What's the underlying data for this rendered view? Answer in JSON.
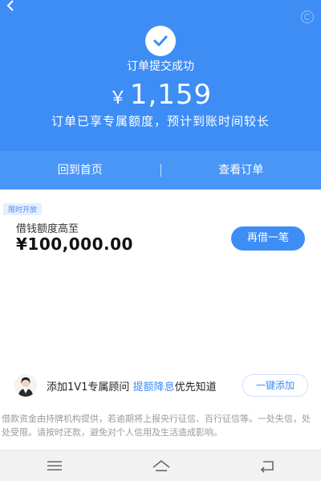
{
  "header": {
    "status_text": "订单提交成功",
    "currency_symbol": "￥",
    "amount": "1,159",
    "notice": "订单已享专属额度，预计到账时间较长",
    "background_color": "#3d8df5"
  },
  "actions": {
    "home_label": "回到首页",
    "view_order_label": "查看订单"
  },
  "card": {
    "badge": "限时开放",
    "limit_label": "借钱额度高至",
    "limit_value": "¥100,000.00",
    "borrow_button": "再借一笔"
  },
  "advisor": {
    "text_prefix": "添加1V1专属顾问 ",
    "highlight": "提额降息",
    "text_suffix": "优先知道",
    "add_button": "一键添加"
  },
  "disclaimer": "借款资金由持牌机构提供，若逾期将上报央行征信、百行征信等。一处失信，处处受限。请按时还款，避免对个人信用及生活造成影响。",
  "icons": {
    "back": "back-arrow-icon",
    "check": "check-icon",
    "menu": "menu-icon",
    "home": "home-icon",
    "return": "return-icon"
  }
}
